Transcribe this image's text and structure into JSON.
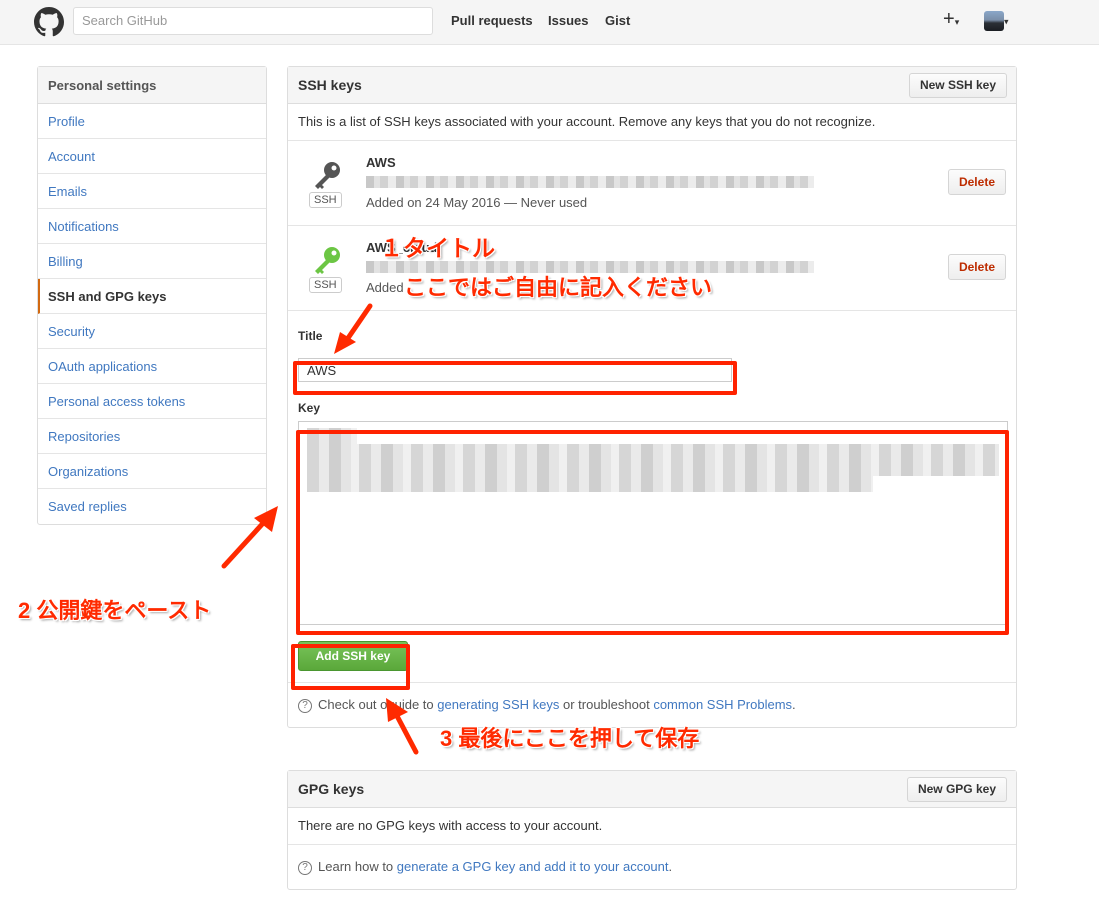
{
  "header": {
    "search_placeholder": "Search GitHub",
    "nav": [
      "Pull requests",
      "Issues",
      "Gist"
    ],
    "plus": "+",
    "caret": "▾"
  },
  "sidebar": {
    "title": "Personal settings",
    "items": [
      {
        "label": "Profile"
      },
      {
        "label": "Account"
      },
      {
        "label": "Emails"
      },
      {
        "label": "Notifications"
      },
      {
        "label": "Billing"
      },
      {
        "label": "SSH and GPG keys",
        "selected": true
      },
      {
        "label": "Security"
      },
      {
        "label": "OAuth applications"
      },
      {
        "label": "Personal access tokens"
      },
      {
        "label": "Repositories"
      },
      {
        "label": "Organizations"
      },
      {
        "label": "Saved replies"
      }
    ]
  },
  "ssh": {
    "title": "SSH keys",
    "new_button": "New SSH key",
    "description": "This is a list of SSH keys associated with your account. Remove any keys that you do not recognize.",
    "keys": [
      {
        "title": "AWS",
        "tag": "SSH",
        "added": "Added on 24 May 2016 — Never used",
        "delete": "Delete",
        "icon": "key-icon-gray"
      },
      {
        "title": "AWS_cloud",
        "tag": "SSH",
        "added": "Added",
        "delete": "Delete",
        "icon": "key-icon-green"
      }
    ],
    "form": {
      "title_label": "Title",
      "title_value": "AWS",
      "key_label": "Key",
      "add_button": "Add SSH key"
    },
    "help": {
      "prefix": "Check out o",
      "middle": "guide to ",
      "link1": "generating SSH keys",
      "or": " or troubleshoot ",
      "link2": "common SSH Problems",
      "end": "."
    }
  },
  "gpg": {
    "title": "GPG keys",
    "new_button": "New GPG key",
    "description": "There are no GPG keys with access to your account.",
    "help_prefix": "Learn how to ",
    "help_link": "generate a GPG key and add it to your account",
    "help_end": "."
  },
  "annotations": {
    "a1_line1": "１タイトル",
    "a1_line2": "ここではご自由に記入ください",
    "a2": "2 公開鍵をペースト",
    "a3": "3 最後にここを押して保存",
    "color": "#ff2a00"
  },
  "colors": {
    "link": "#4078c0",
    "add_button": "#6cc644",
    "delete_text": "#bd2c00",
    "selected_accent": "#d26911"
  }
}
